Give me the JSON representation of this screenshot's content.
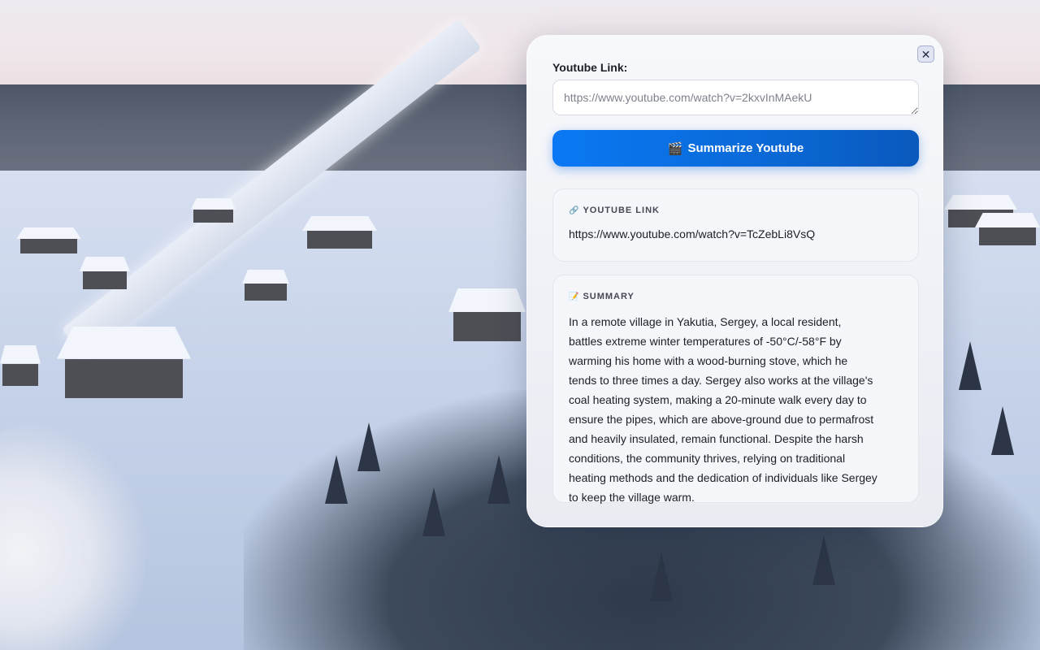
{
  "panel": {
    "field_label": "Youtube Link:",
    "input_placeholder": "https://www.youtube.com/watch?v=2kxvInMAekU",
    "input_value": "",
    "close_icon": "✕",
    "summarize_button": {
      "icon": "🎬",
      "label": "Summarize Youtube"
    },
    "link_card": {
      "icon": "🔗",
      "heading": "YOUTUBE LINK",
      "url": "https://www.youtube.com/watch?v=TcZebLi8VsQ"
    },
    "summary_card": {
      "icon": "📝",
      "heading": "SUMMARY",
      "text": "In a remote village in Yakutia, Sergey, a local resident, battles extreme winter temperatures of -50°C/-58°F by warming his home with a wood-burning stove, which he tends to three times a day. Sergey also works at the village's coal heating system, making a 20-minute walk every day to ensure the pipes, which are above-ground due to permafrost and heavily insulated, remain functional. Despite the harsh conditions, the community thrives, relying on traditional heating methods and the dedication of individuals like Sergey to keep the village warm."
    }
  },
  "colors": {
    "button_start": "#0a78f4",
    "button_end": "#0a59bd",
    "panel_bg": "#f2f4f8"
  }
}
